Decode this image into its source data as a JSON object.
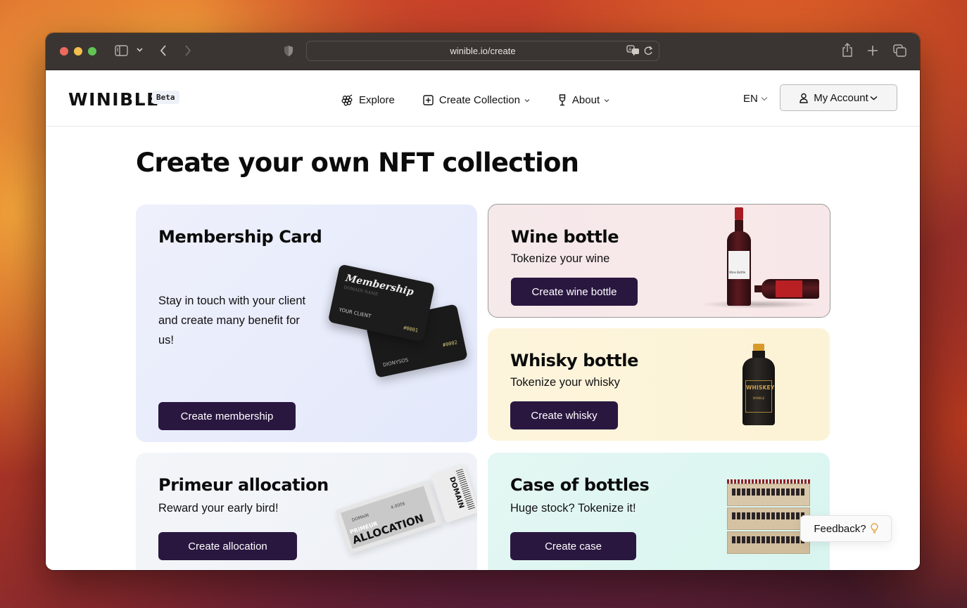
{
  "browser": {
    "url": "winible.io/create",
    "icons": [
      "sidebar-icon",
      "chevron-down-icon",
      "back-icon",
      "forward-icon",
      "shield-icon",
      "translate-icon",
      "reload-icon",
      "share-icon",
      "new-tab-icon",
      "tabs-overview-icon"
    ]
  },
  "header": {
    "logo": "WINIBLE",
    "badge": "Beta",
    "nav": [
      {
        "label": "Explore",
        "icon": "grapes-icon"
      },
      {
        "label": "Create Collection",
        "icon": "plus-square-icon",
        "dropdown": true
      },
      {
        "label": "About",
        "icon": "wine-glass-icon",
        "dropdown": true
      }
    ],
    "language": "EN",
    "account_label": "My Account"
  },
  "page": {
    "title": "Create your own NFT collection"
  },
  "cards": {
    "membership": {
      "title": "Membership Card",
      "description": "Stay in touch with your client and create many benefit for us!",
      "button": "Create membership",
      "image": {
        "front_title": "Membership",
        "front_subtitle": "DOMAIN NAME",
        "front_client": "YOUR CLIENT",
        "front_number": "#0001",
        "back_client": "DIONYSOS",
        "back_number": "#0002"
      }
    },
    "wine": {
      "title": "Wine bottle",
      "subtitle": "Tokenize your wine",
      "button": "Create wine bottle",
      "image": {
        "label": "Wine Bottle"
      }
    },
    "whisky": {
      "title": "Whisky bottle",
      "subtitle": "Tokenize your whisky",
      "button": "Create whisky",
      "image": {
        "label": "WHISKEY",
        "sublabel": "WINIBLE"
      }
    },
    "primeur": {
      "title": "Primeur allocation",
      "subtitle": "Reward your early bird!",
      "button": "Create allocation",
      "image": {
        "label_small": "PRIMEUR",
        "label_big": "ALLOCATION",
        "domain": "DOMAIN",
        "price": "4.000$",
        "stub": "DOMAIN"
      }
    },
    "case": {
      "title": "Case of bottles",
      "subtitle": "Huge stock? Tokenize it!",
      "button": "Create case"
    }
  },
  "feedback": {
    "label": "Feedback?",
    "icon": "lightbulb-icon"
  },
  "colors": {
    "button_bg": "#2a1740",
    "membership_bg": "#e7ebfb",
    "wine_bg": "#f7e8e9",
    "whisky_bg": "#fdf4da",
    "primeur_bg": "#f1f3f8",
    "case_bg": "#ddf6f0",
    "feedback_icon": "#e0a030"
  }
}
